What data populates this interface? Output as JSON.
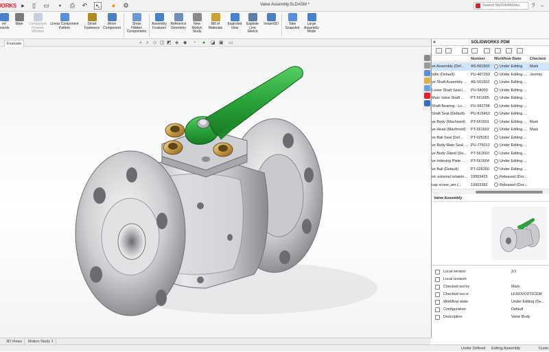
{
  "app": {
    "logo_text": "SOLIDWORKS",
    "title": "Valve Assembly.SLDASM *",
    "search_placeholder": "Search MySolidWorks"
  },
  "colors": {
    "brand": "#d9232d",
    "handle": "#2aa33a",
    "selection": "#cfe4fb"
  },
  "quick_access": [
    "play-arrow-icon",
    "new-document-icon",
    "open-folder-icon",
    "save-icon",
    "print-icon",
    "undo-icon",
    "select-pointer-icon",
    "rebuild-icon",
    "options-gear-icon"
  ],
  "commands": [
    {
      "label": "ert\nonents",
      "disabled": false,
      "icon": "insert-components-icon"
    },
    {
      "label": "Mate",
      "disabled": false,
      "icon": "mate-icon"
    },
    {
      "label": "Component\nPreview\nWindow",
      "disabled": true,
      "icon": "preview-window-icon"
    },
    {
      "label": "Linear Component\nPattern",
      "disabled": false,
      "icon": "linear-pattern-icon"
    },
    {
      "label": "Smart\nFasteners",
      "disabled": false,
      "icon": "smart-fasteners-icon"
    },
    {
      "label": "Move\nComponent",
      "disabled": false,
      "icon": "move-component-icon"
    },
    {
      "label": "Show\nHidden\nComponents",
      "disabled": false,
      "icon": "show-hidden-icon"
    },
    {
      "label": "Assembly\nFeatures",
      "disabled": false,
      "icon": "assembly-features-icon"
    },
    {
      "label": "Reference\nGeometry",
      "disabled": false,
      "icon": "reference-geometry-icon"
    },
    {
      "label": "New\nMotion\nStudy",
      "disabled": false,
      "icon": "motion-study-icon"
    },
    {
      "label": "Bill of\nMaterials",
      "disabled": false,
      "icon": "bill-of-materials-icon"
    },
    {
      "label": "Exploded\nView",
      "disabled": false,
      "icon": "exploded-view-icon"
    },
    {
      "label": "Explode\nLine\nSketch",
      "disabled": false,
      "icon": "explode-line-icon"
    },
    {
      "label": "Instant3D",
      "disabled": false,
      "icon": "instant3d-icon"
    },
    {
      "label": "Take\nSnapshot",
      "disabled": false,
      "icon": "snapshot-icon"
    },
    {
      "label": "Large\nAssembly\nMode",
      "disabled": false,
      "icon": "large-assembly-icon"
    }
  ],
  "ribbon_tabs": [
    "Evaluate"
  ],
  "bottom_tabs": [
    "3D Views",
    "Motion Study 1"
  ],
  "status": {
    "state": "Under Defined",
    "mode": "Editing Assembly",
    "custom": "Custo"
  },
  "pdm": {
    "header": "SOLIDWORKS PDM",
    "columns": [
      "Number",
      "Workflow State",
      "Checked Ou"
    ],
    "rows": [
      {
        "name": "ve Assembly  (Def...",
        "number": "AS-561600",
        "state": "Under Editing",
        "checked_out_by": "Mark",
        "selected": true
      },
      {
        "name": "ndle  (Default)",
        "number": "PU-467260",
        "state": "Under Editing ...",
        "checked_out_by": "Jeremy",
        "selected": false
      },
      {
        "name": "ve Shaft Assembly ...",
        "number": "AS-561602",
        "state": "Under Editing ...",
        "checked_out_by": "",
        "selected": false
      },
      {
        "name": "Lower Shaft Seal  (...",
        "number": "PU-54000",
        "state": "Under Editing ...",
        "checked_out_by": "",
        "selected": false
      },
      {
        "name": "Main Valve Shaft  ...",
        "number": "PT-561605",
        "state": "Under Editing ...",
        "checked_out_by": "",
        "selected": false
      },
      {
        "name": "Shaft Bearing - Lo...",
        "number": "PU-682798",
        "state": "Under Editing ...",
        "checked_out_by": "",
        "selected": false
      },
      {
        "name": "Shaft Seal  (Default)",
        "number": "PU-815463",
        "state": "Under Editing ...",
        "checked_out_by": "",
        "selected": false
      },
      {
        "name": "ve Body  (Machined)",
        "number": "PT-561601",
        "state": "Under Editing ...",
        "checked_out_by": "Mark",
        "selected": false
      },
      {
        "name": "ve Head  (Machined)",
        "number": "PT-561602",
        "state": "Under Editing ...",
        "checked_out_by": "Mark",
        "selected": false
      },
      {
        "name": "ve Ball Seal  (Def...",
        "number": "PT-025261",
        "state": "Under Editing ...",
        "checked_out_by": "",
        "selected": false
      },
      {
        "name": "ve Body Main Seal ...",
        "number": "PU-775012",
        "state": "Under Editing ...",
        "checked_out_by": "",
        "selected": false
      },
      {
        "name": "ve Body Gland  (De...",
        "number": "PT-561603",
        "state": "Under Editing ...",
        "checked_out_by": "",
        "selected": false
      },
      {
        "name": "ve Indexing Plate  ...",
        "number": "PT-561604",
        "state": "Under Editing ...",
        "checked_out_by": "",
        "selected": false
      },
      {
        "name": "ve Ball  (Default)",
        "number": "PT-025260",
        "state": "Under Editing ...",
        "checked_out_by": "",
        "selected": false
      },
      {
        "name": "sic external retainin...",
        "number": "10003423",
        "state": "Released (Doc...",
        "checked_out_by": "",
        "selected": false
      },
      {
        "name": "cap screw_am  (...",
        "number": "10003382",
        "state": "Released (Doc...",
        "checked_out_by": "",
        "selected": false
      }
    ],
    "preview_label": "Valve Assembly",
    "properties": [
      {
        "label": "Local version",
        "value": "1/1",
        "icon": "version-icon"
      },
      {
        "label": "Local revision",
        "value": "",
        "icon": "revision-icon"
      },
      {
        "label": "Checked out by",
        "value": "Mark",
        "icon": "user-icon"
      },
      {
        "label": "Checked out in",
        "value": "LENOVO272CEM",
        "icon": "computer-icon"
      },
      {
        "label": "Workflow state",
        "value": "Under Editing (De...",
        "icon": "workflow-icon"
      },
      {
        "label": "Configuration",
        "value": "Default",
        "icon": "configuration-icon"
      },
      {
        "label": "Description",
        "value": "Valve Body",
        "icon": "description-icon"
      }
    ]
  }
}
